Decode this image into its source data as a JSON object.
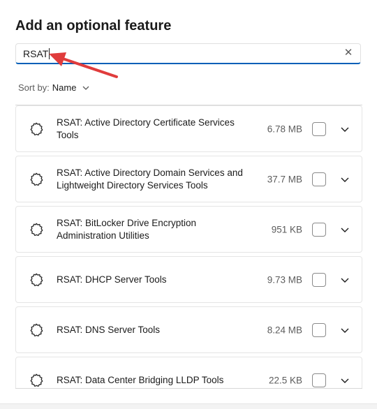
{
  "dialog": {
    "title": "Add an optional feature"
  },
  "search": {
    "value": "RSAT",
    "clear_icon": "✕"
  },
  "sort": {
    "label": "Sort by:",
    "value": "Name"
  },
  "features": [
    {
      "name": "RSAT: Active Directory Certificate Services Tools",
      "size": "6.78 MB",
      "checked": false
    },
    {
      "name": "RSAT: Active Directory Domain Services and Lightweight Directory Services Tools",
      "size": "37.7 MB",
      "checked": false
    },
    {
      "name": "RSAT: BitLocker Drive Encryption Administration Utilities",
      "size": "951 KB",
      "checked": false
    },
    {
      "name": "RSAT: DHCP Server Tools",
      "size": "9.73 MB",
      "checked": false
    },
    {
      "name": "RSAT: DNS Server Tools",
      "size": "8.24 MB",
      "checked": false
    },
    {
      "name": "RSAT: Data Center Bridging LLDP Tools",
      "size": "22.5 KB",
      "checked": false
    }
  ],
  "icons": {
    "feature": "puzzle-gear-icon",
    "expand": "chevron-down-icon",
    "clear": "close-icon"
  },
  "colors": {
    "accent": "#005fb8",
    "annotation_arrow": "#e03c3c"
  }
}
